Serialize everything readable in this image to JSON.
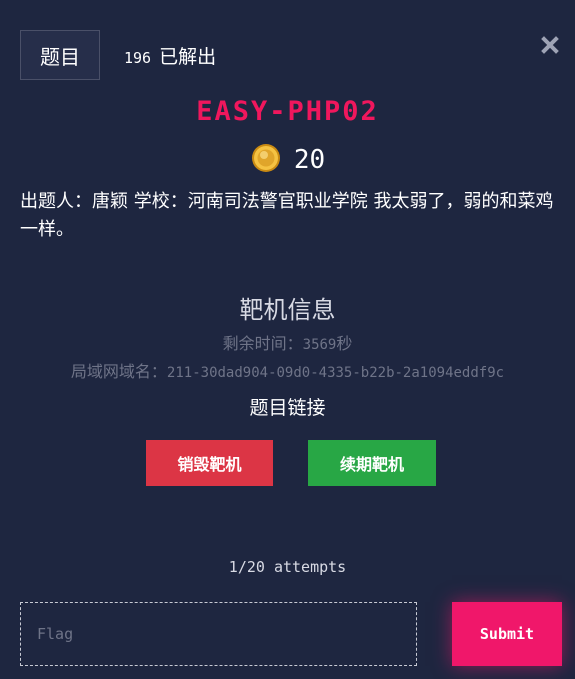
{
  "header": {
    "tab_label": "题目",
    "solve_count": "196",
    "solve_label": "已解出"
  },
  "challenge": {
    "name": "EASY-PHP02",
    "points": "20",
    "description": "出题人：唐颖 学校：河南司法警官职业学院 我太弱了，弱的和菜鸡一样。"
  },
  "target": {
    "heading": "靶机信息",
    "remaining_label": "剩余时间：",
    "remaining_value": "3569",
    "remaining_unit": "秒",
    "domain_label": "局域网域名：",
    "domain_value": "211-30dad904-09d0-4335-b22b-2a1094eddf9c",
    "link_label": "题目链接",
    "destroy_label": "销毁靶机",
    "renew_label": "续期靶机"
  },
  "submission": {
    "attempts": "1/20 attempts",
    "flag_placeholder": "Flag",
    "submit_label": "Submit"
  },
  "colors": {
    "background": "#1e2640",
    "title": "#f0175d",
    "destroy": "#dc3545",
    "renew": "#28a745",
    "submit": "#f0176a"
  },
  "icons": {
    "close": "close-icon",
    "points": "coin-icon"
  }
}
